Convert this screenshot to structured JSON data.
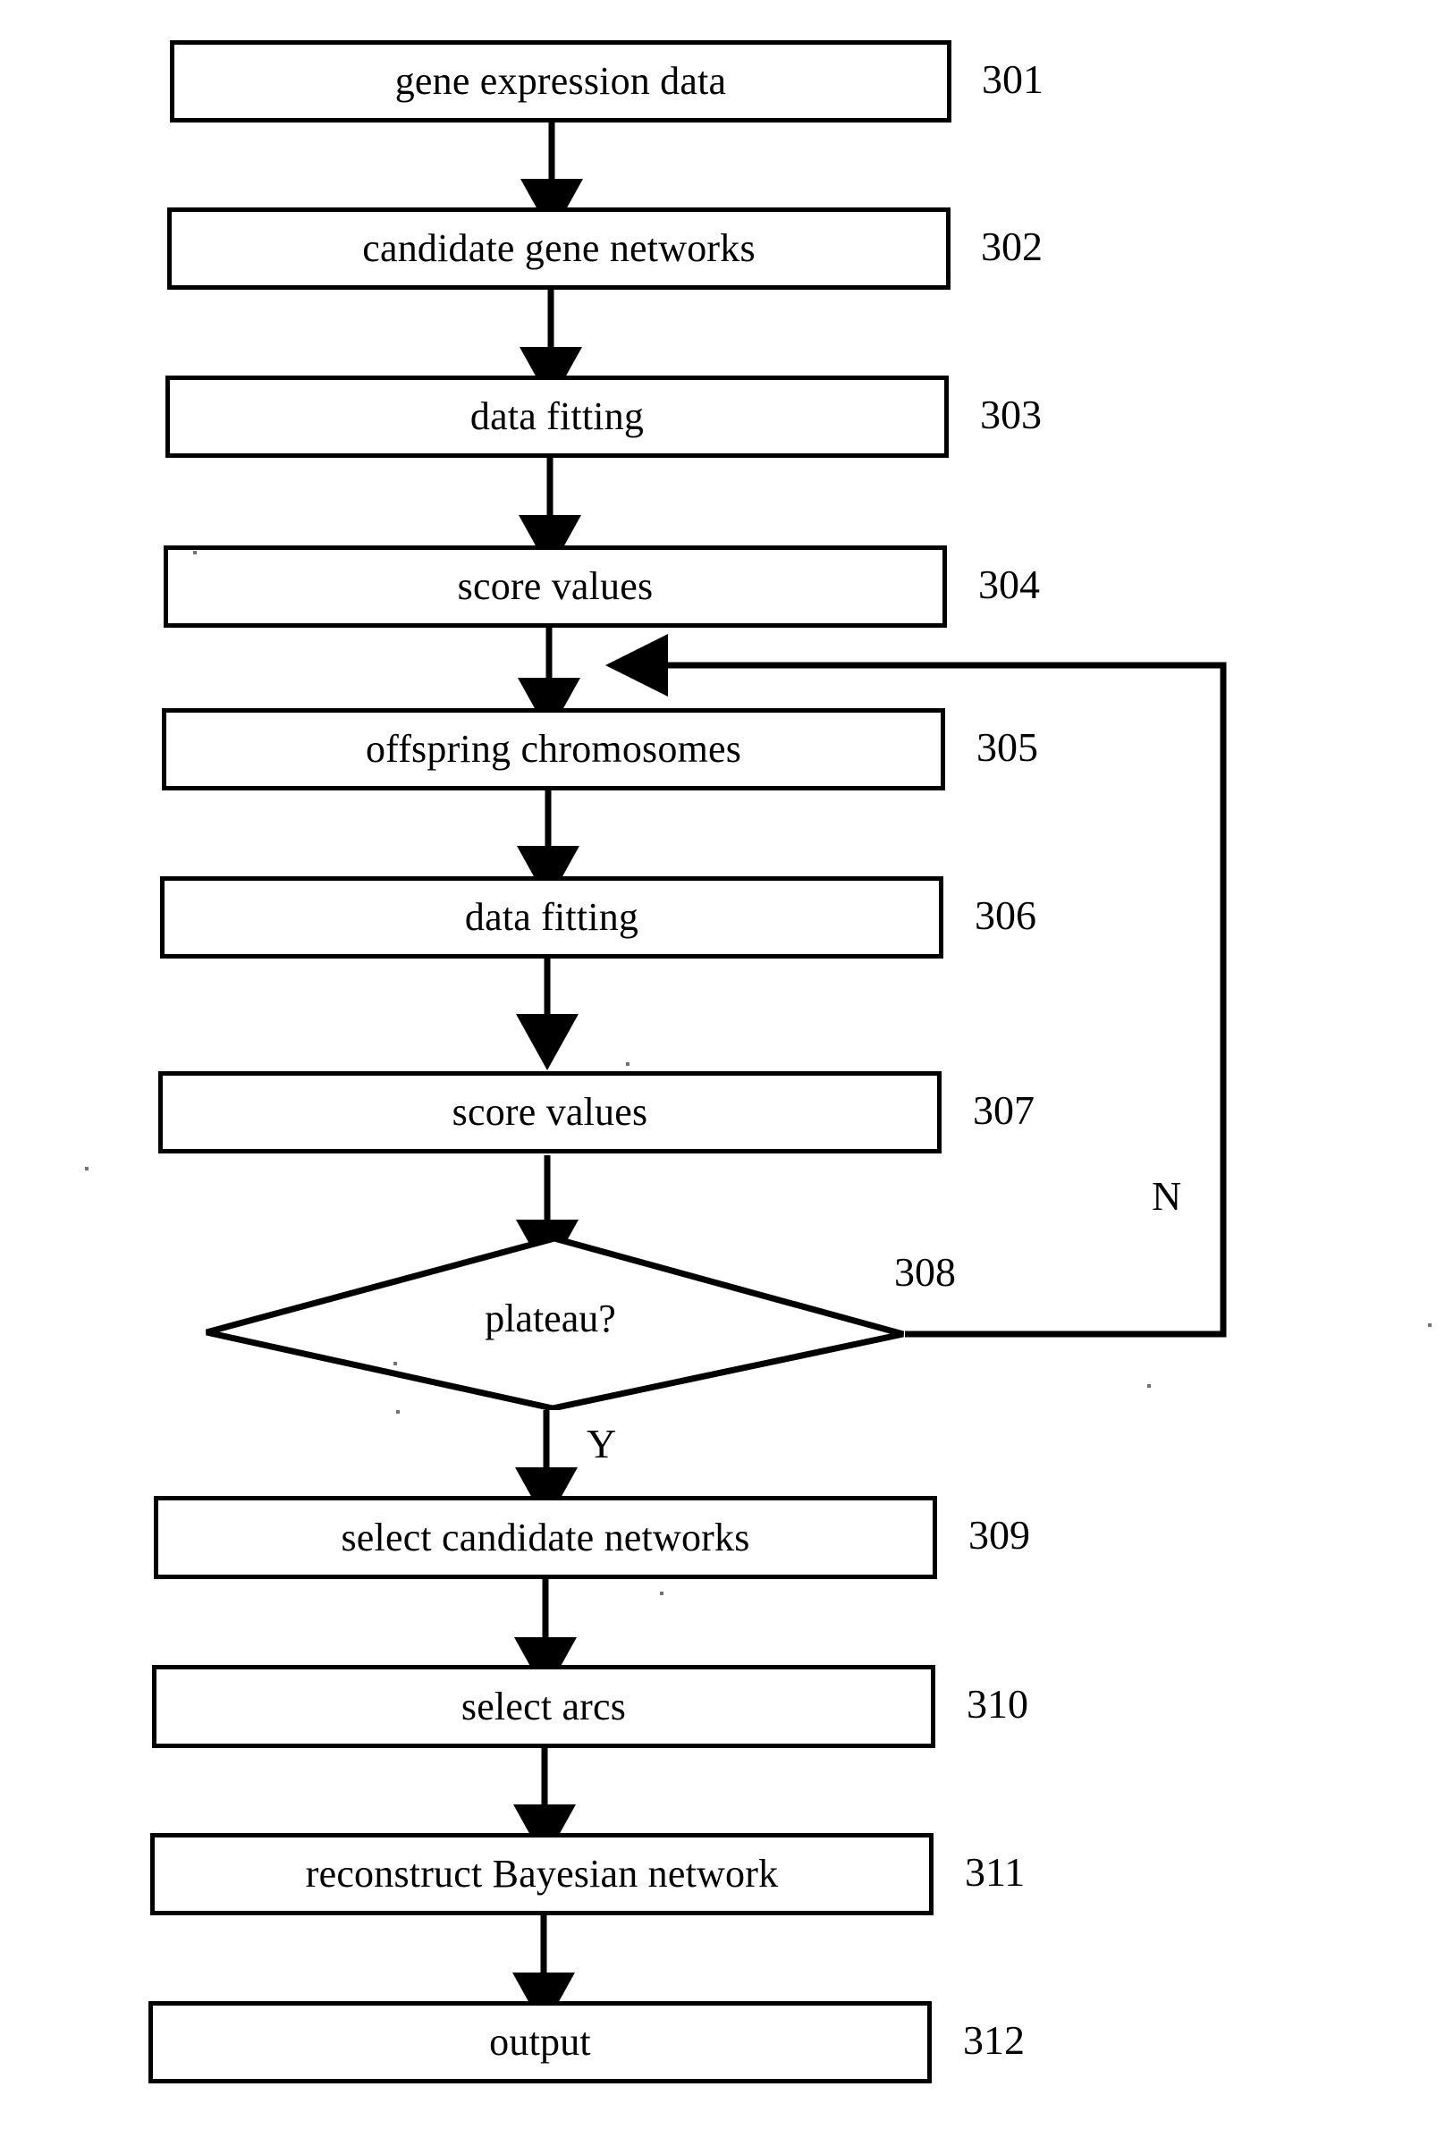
{
  "figure": {
    "type": "flowchart",
    "orientation": "vertical",
    "ink_color": "#000000",
    "background_color": "#ffffff"
  },
  "nodes": [
    {
      "id": "301",
      "shape": "rectangle",
      "label": "gene expression data",
      "ref": "301"
    },
    {
      "id": "302",
      "shape": "rectangle",
      "label": "candidate gene networks",
      "ref": "302"
    },
    {
      "id": "303",
      "shape": "rectangle",
      "label": "data fitting",
      "ref": "303"
    },
    {
      "id": "304",
      "shape": "rectangle",
      "label": "score values",
      "ref": "304"
    },
    {
      "id": "305",
      "shape": "rectangle",
      "label": "offspring chromosomes",
      "ref": "305"
    },
    {
      "id": "306",
      "shape": "rectangle",
      "label": "data fitting",
      "ref": "306"
    },
    {
      "id": "307",
      "shape": "rectangle",
      "label": "score values",
      "ref": "307"
    },
    {
      "id": "308",
      "shape": "diamond",
      "label": "plateau?",
      "ref": "308"
    },
    {
      "id": "309",
      "shape": "rectangle",
      "label": "select candidate networks",
      "ref": "309"
    },
    {
      "id": "310",
      "shape": "rectangle",
      "label": "select arcs",
      "ref": "310"
    },
    {
      "id": "311",
      "shape": "rectangle",
      "label": "reconstruct Bayesian network",
      "ref": "311"
    },
    {
      "id": "312",
      "shape": "rectangle",
      "label": "output",
      "ref": "312"
    }
  ],
  "branch_labels": {
    "no": "N",
    "yes": "Y"
  },
  "edges": [
    {
      "from": "301",
      "to": "302",
      "label": ""
    },
    {
      "from": "302",
      "to": "303",
      "label": ""
    },
    {
      "from": "303",
      "to": "304",
      "label": ""
    },
    {
      "from": "304",
      "to": "305",
      "label": ""
    },
    {
      "from": "305",
      "to": "306",
      "label": ""
    },
    {
      "from": "306",
      "to": "307",
      "label": ""
    },
    {
      "from": "307",
      "to": "308",
      "label": ""
    },
    {
      "from": "308",
      "to": "309",
      "label": "Y"
    },
    {
      "from": "308",
      "to": "305",
      "label": "N"
    },
    {
      "from": "309",
      "to": "310",
      "label": ""
    },
    {
      "from": "310",
      "to": "311",
      "label": ""
    },
    {
      "from": "311",
      "to": "312",
      "label": ""
    }
  ]
}
